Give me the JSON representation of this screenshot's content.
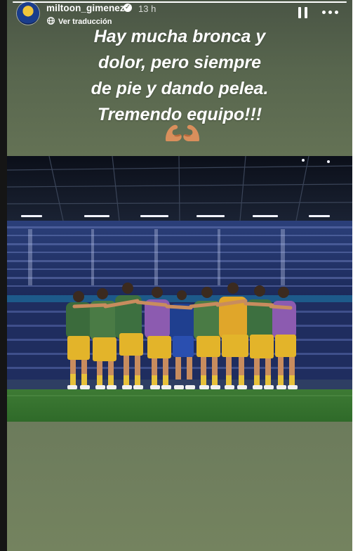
{
  "story": {
    "progress": 1.0,
    "header": {
      "username": "miltoon_gimenez",
      "verified_icon": "verified-badge-icon",
      "time": "13 h",
      "translate_label": "Ver traducción"
    },
    "controls": {
      "pause_icon": "pause-icon",
      "more_icon": "more-options-icon"
    },
    "caption_lines": [
      "Hay mucha bronca y",
      "dolor, pero siempre",
      "de pie y dando pelea.",
      "Tremendo equipo!!!"
    ],
    "emoji": "flexed-biceps-icon",
    "photo": {
      "subject": "team-huddle-photo"
    },
    "colors": {
      "background_top": "#4a5545",
      "background_bottom": "#74835f",
      "text": "#ffffff"
    }
  }
}
